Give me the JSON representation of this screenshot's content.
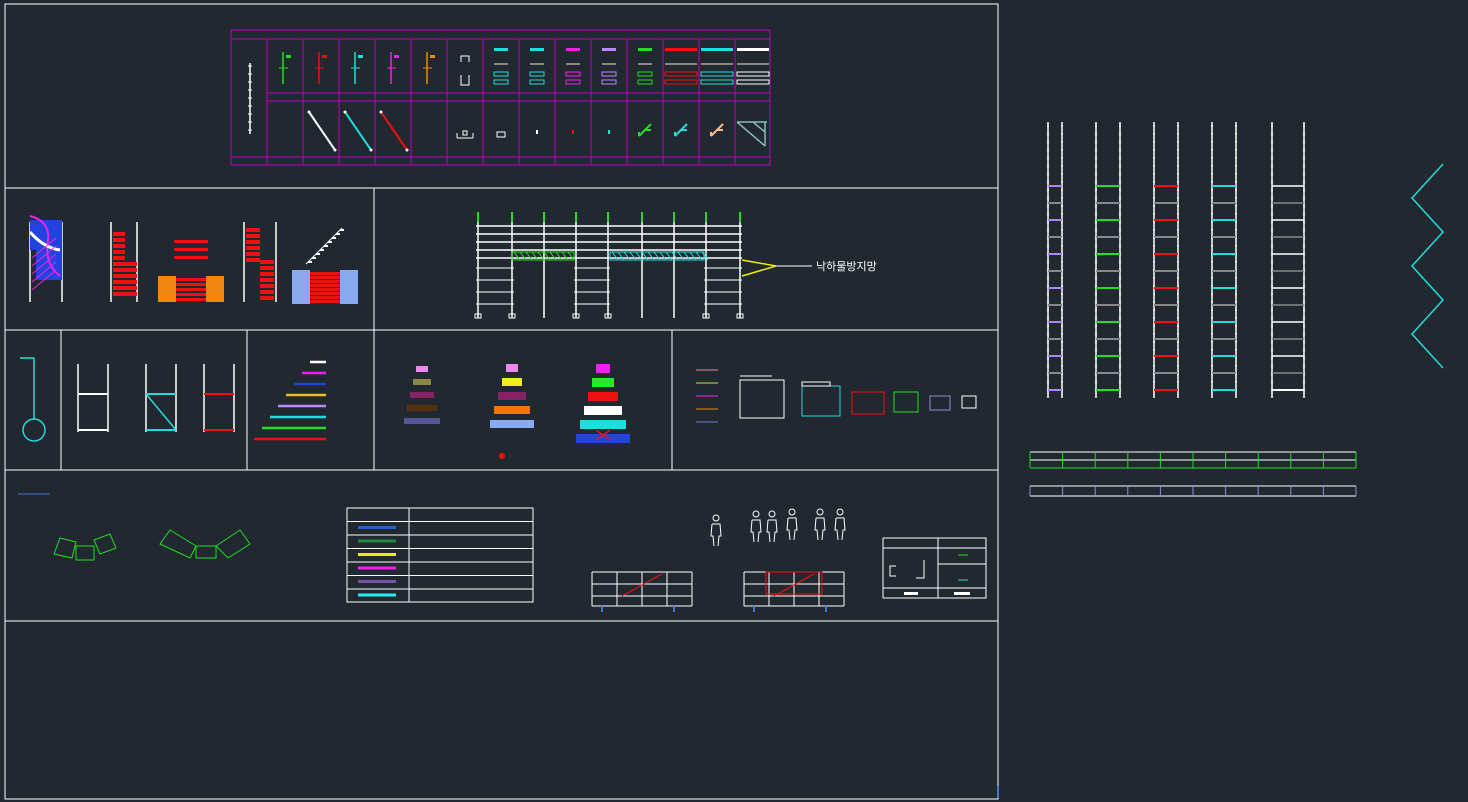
{
  "drawing": {
    "annotation_label": "낙하물방지망"
  },
  "colors": {
    "background": "#212830",
    "frame": "#ffffff",
    "table_grid": "#c000c0",
    "green": "#22dd22",
    "red": "#ee1111",
    "cyan": "#22dddd",
    "magenta": "#ee22ee",
    "blue": "#2244dd",
    "orange": "#ee8811",
    "yellow": "#eeee11",
    "gray": "#aaaaaa",
    "purple": "#9988dd",
    "periwinkle": "#88aaee"
  },
  "legend_swatches": [
    "#2266cc",
    "#228844",
    "#eeee11",
    "#ee22ee",
    "#7755aa",
    "#22eeee"
  ],
  "stair_lines": [
    "#ffffff",
    "#ee22ee",
    "#2244dd",
    "#eebb22",
    "#bb88ff",
    "#22dddd",
    "#22dd22",
    "#ee1111"
  ],
  "stack_a": [
    "#ee88ee",
    "#888844",
    "#882266",
    "#553311",
    "#555599"
  ],
  "stack_b": [
    "#ee88ee",
    "#eeee22",
    "#882266",
    "#ee7711",
    "#88aaee"
  ],
  "stack_c": [
    "#ee22ee",
    "#22ee22",
    "#ee1111",
    "#ffffff",
    "#22dddd",
    "#2244dd"
  ],
  "short_lines": [
    "#ee88aa",
    "#aaee44",
    "#ee22ee",
    "#ee8811",
    "#6688cc"
  ],
  "tower_accents": [
    "#aa88ee",
    "#22dd22",
    "#ee1111",
    "#22dddd",
    "#ffffff"
  ],
  "palette_cells": [
    {
      "color": "#22dd22",
      "icon": "post"
    },
    {
      "color": "#ee1111",
      "icon": "post"
    },
    {
      "color": "#22dddd",
      "icon": "post"
    },
    {
      "color": "#ee22ee",
      "icon": "post"
    },
    {
      "color": "#ee8811",
      "icon": "post"
    },
    {
      "color": "#ffffff",
      "icon": "clamp"
    },
    {
      "color": "#22dddd",
      "icon": "plank"
    },
    {
      "color": "#22dddd",
      "icon": "plank"
    },
    {
      "color": "#ee22ee",
      "icon": "plank"
    },
    {
      "color": "#bb88ff",
      "icon": "plank"
    },
    {
      "color": "#22dd22",
      "icon": "plank"
    },
    {
      "color": "#ee1111",
      "icon": "plank"
    },
    {
      "color": "#22dddd",
      "icon": "plank"
    },
    {
      "color": "#ffffff",
      "icon": "plank"
    }
  ],
  "palette_row2": [
    {
      "color": "#ffffff",
      "icon": "none"
    },
    {
      "color": "#ffffff",
      "icon": "diag"
    },
    {
      "color": "#22dddd",
      "icon": "diag"
    },
    {
      "color": "#ee1111",
      "icon": "diag"
    },
    {
      "color": "#ffffff",
      "icon": "none"
    },
    {
      "color": "#ffffff",
      "icon": "clamp2"
    },
    {
      "color": "#ffffff",
      "icon": "box"
    },
    {
      "color": "#ffffff",
      "icon": "dot"
    },
    {
      "color": "#ee1111",
      "icon": "dot"
    },
    {
      "color": "#22dddd",
      "icon": "dot"
    },
    {
      "color": "#22dd22",
      "icon": "bracket"
    },
    {
      "color": "#22dddd",
      "icon": "bracket"
    },
    {
      "color": "#ffbb88",
      "icon": "bracket"
    },
    {
      "color": "#88bbbb",
      "icon": "truss"
    }
  ]
}
